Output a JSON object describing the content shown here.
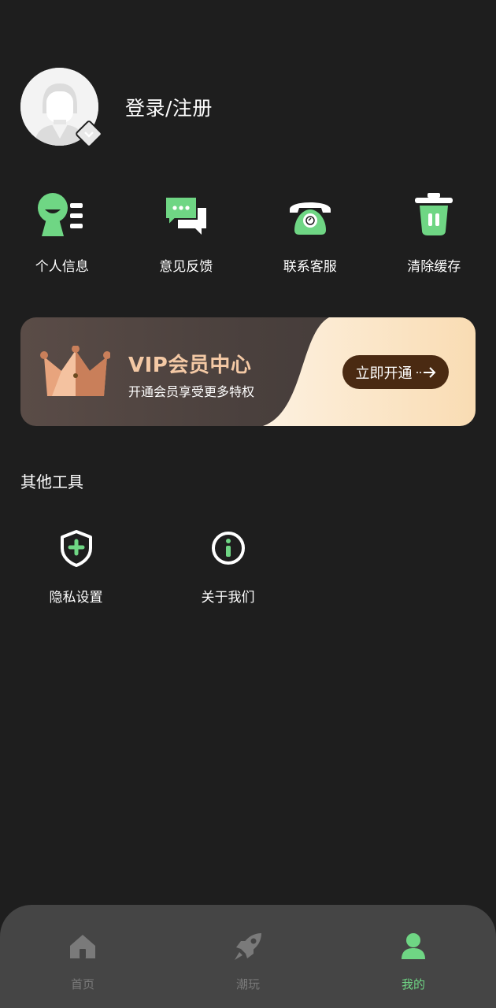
{
  "profile": {
    "login_text": "登录/注册"
  },
  "actions": [
    {
      "label": "个人信息",
      "icon": "user-info-icon"
    },
    {
      "label": "意见反馈",
      "icon": "feedback-chat-icon"
    },
    {
      "label": "联系客服",
      "icon": "phone-icon"
    },
    {
      "label": "清除缓存",
      "icon": "trash-icon"
    }
  ],
  "vip": {
    "title": "VIP会员中心",
    "subtitle": "开通会员享受更多特权",
    "button": "立即开通"
  },
  "tools": {
    "title": "其他工具",
    "items": [
      {
        "label": "隐私设置",
        "icon": "shield-plus-icon"
      },
      {
        "label": "关于我们",
        "icon": "info-icon"
      }
    ]
  },
  "nav": {
    "items": [
      {
        "label": "首页",
        "icon": "home-icon"
      },
      {
        "label": "潮玩",
        "icon": "rocket-icon"
      },
      {
        "label": "我的",
        "icon": "person-icon"
      }
    ],
    "active": "我的"
  },
  "colors": {
    "background": "#1e1e1e",
    "accent_green": "#6fd684",
    "nav_bg": "#454545",
    "vip_gold": "#f4c9a5",
    "vip_button": "#4a2a12"
  }
}
